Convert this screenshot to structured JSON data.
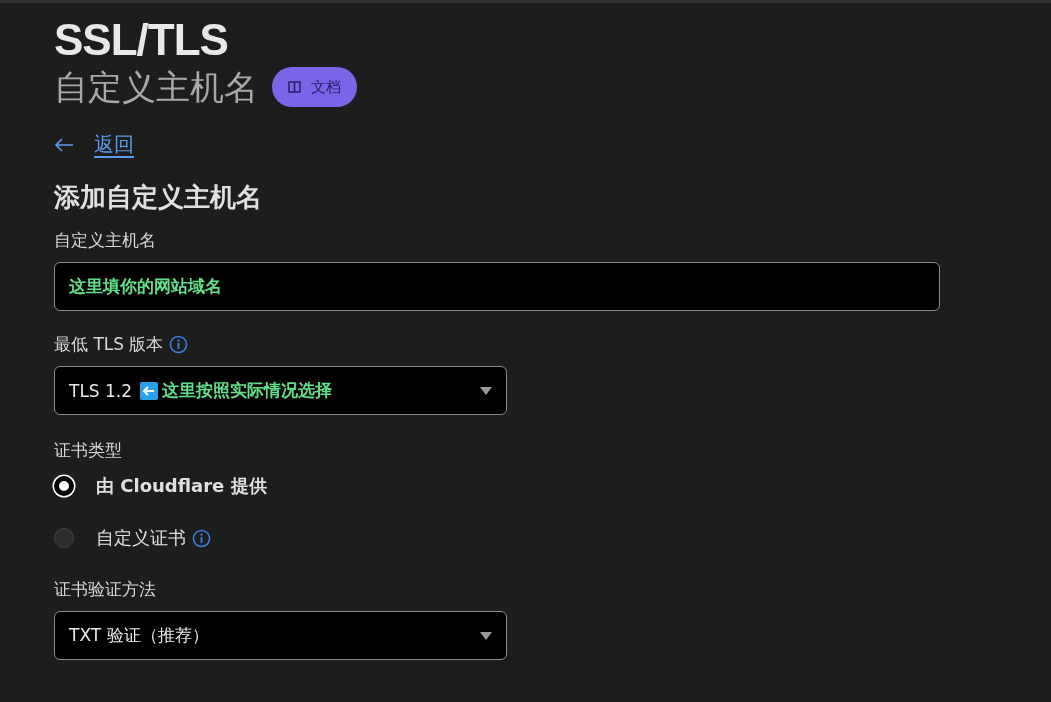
{
  "header": {
    "title": "SSL/TLS",
    "subtitle": "自定义主机名",
    "docs_button": "文档"
  },
  "back_link": "返回",
  "form": {
    "heading": "添加自定义主机名",
    "hostname": {
      "label": "自定义主机名",
      "value": "这里填你的网站域名"
    },
    "min_tls": {
      "label": "最低 TLS 版本",
      "value": "TLS 1.2",
      "annotation": "这里按照实际情况选择"
    },
    "cert_type": {
      "label": "证书类型",
      "options": [
        {
          "label": "由 Cloudflare 提供",
          "selected": true,
          "info": false
        },
        {
          "label": "自定义证书",
          "selected": false,
          "info": true
        }
      ]
    },
    "validation": {
      "label": "证书验证方法",
      "value": "TXT 验证（推荐）"
    }
  }
}
